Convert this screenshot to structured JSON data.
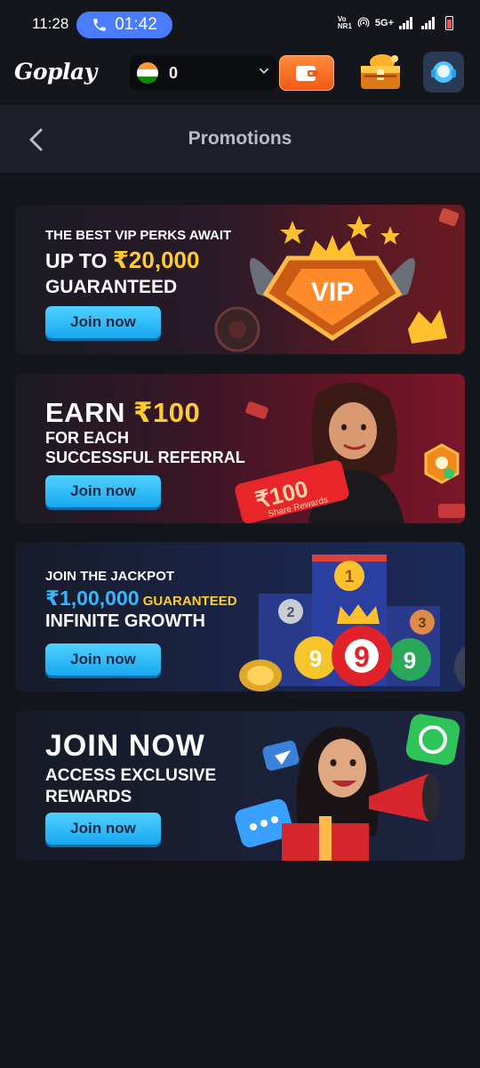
{
  "status_bar": {
    "time": "11:28",
    "call_timer": "01:42",
    "network_label": "5G+",
    "volte_label": "Vo NR1"
  },
  "header": {
    "logo_text": "Goplay",
    "balance": "0",
    "flag": "india"
  },
  "page": {
    "title": "Promotions"
  },
  "promos": [
    {
      "line1": "THE BEST VIP PERKS AWAIT",
      "line2_prefix": "UP TO ",
      "line2_amount": "₹20,000",
      "line3": "GUARANTEED",
      "badge": "VIP",
      "button": "Join now"
    },
    {
      "line1_prefix": "EARN ",
      "line1_amount": "₹100",
      "line2": "FOR EACH",
      "line3": "SUCCESSFUL REFERRAL",
      "ticket_amount": "₹100",
      "ticket_caption": "Share Rewards",
      "button": "Join now"
    },
    {
      "line1": "JOIN THE JACKPOT",
      "line2_amount": "₹1,00,000",
      "line2_suffix": " GUARANTEED",
      "line3": "INFINITE GROWTH",
      "ball_big": "9",
      "ball_left": "9",
      "ball_right": "9",
      "podium_1": "1",
      "podium_2": "2",
      "podium_3": "3",
      "button": "Join now"
    },
    {
      "line1": "JOIN NOW",
      "line2": "ACCESS EXCLUSIVE",
      "line3": "REWARDS",
      "button": "Join now"
    }
  ],
  "colors": {
    "accent_yellow": "#ffcc2e",
    "accent_blue": "#36b8ff",
    "button_blue": "#18a8f0",
    "wallet_orange": "#f05a14",
    "call_pill": "#4a7cff"
  }
}
